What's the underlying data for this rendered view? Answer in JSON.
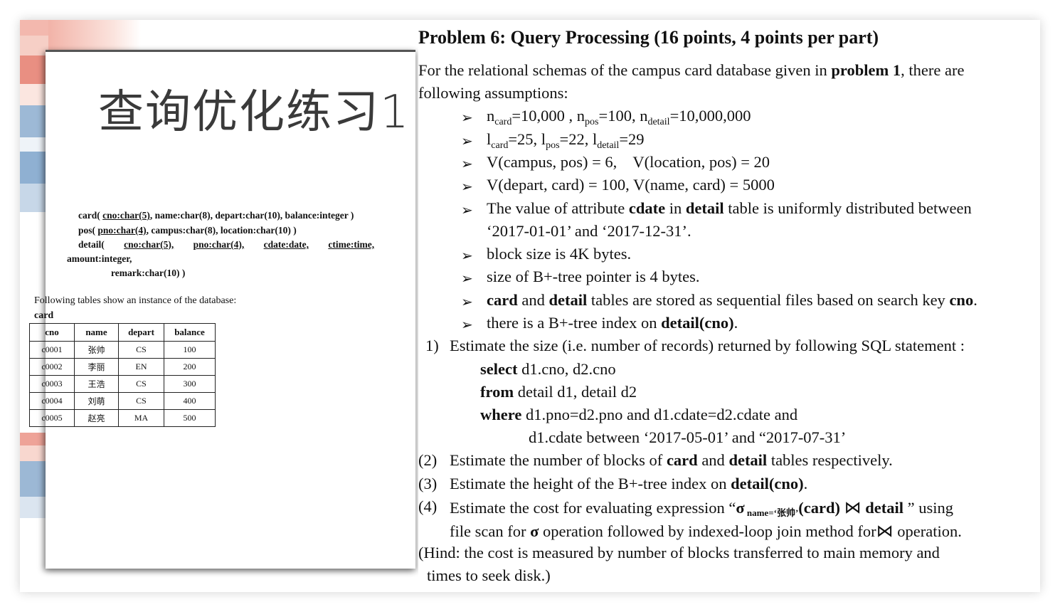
{
  "left": {
    "title": "查询优化练习1",
    "schema": {
      "card_prefix": "card( ",
      "card_key": "cno:char(5)",
      "card_rest": ", name:char(8), depart:char(10), balance:integer )",
      "pos_prefix": "pos( ",
      "pos_key": "pno:char(4)",
      "pos_rest": ", campus:char(8), location:char(10) )",
      "detail_prefix": "detail(",
      "detail_k1": "cno:char(5),",
      "detail_k2": "pno:char(4),",
      "detail_k3": "cdate:date,",
      "detail_k4": "ctime:time,",
      "detail_l2": "amount:integer,",
      "detail_l3": "remark:char(10) )"
    },
    "instance_note": "Following tables show an instance of the database:",
    "table_label": "card",
    "table": {
      "headers": [
        "cno",
        "name",
        "depart",
        "balance"
      ],
      "rows": [
        [
          "c0001",
          "张帅",
          "CS",
          "100"
        ],
        [
          "c0002",
          "李丽",
          "EN",
          "200"
        ],
        [
          "c0003",
          "王浩",
          "CS",
          "300"
        ],
        [
          "c0004",
          "刘萌",
          "CS",
          "400"
        ],
        [
          "c0005",
          "赵亮",
          "MA",
          "500"
        ]
      ]
    }
  },
  "right": {
    "problem_title": "Problem 6: Query Processing (16 points, 4 points per part)",
    "intro_a": "For the relational schemas of the campus card database given in ",
    "intro_b": "problem 1",
    "intro_c": ", there are",
    "intro_2": "following assumptions:",
    "b1": {
      "n": "n",
      "s1": "card",
      "t1": "=10,000 , n",
      "s2": "pos",
      "t2": "=100, n",
      "s3": "detail",
      "t3": "=10,000,000"
    },
    "b2": {
      "l": "l",
      "s1": "card",
      "t1": "=25, l",
      "s2": "pos",
      "t2": "=22, l",
      "s3": "detail",
      "t3": "=29"
    },
    "b3": "V(campus, pos) = 6,    V(location, pos) = 20",
    "b4": "V(depart, card) = 100, V(name, card) = 5000",
    "b5": {
      "a": "The value of attribute ",
      "b": "cdate",
      "c": " in ",
      "d": "detail",
      "e": " table is uniformly distributed between",
      "l2": "‘2017-01-01’ and ‘2017-12-31’."
    },
    "b6": "block size is 4K bytes.",
    "b7": "size of B+-tree pointer is 4 bytes.",
    "b8": {
      "a": "card",
      "b": " and ",
      "c": "detail",
      "d": " tables are stored as sequential files based on search key ",
      "e": "cno",
      "f": "."
    },
    "b9": {
      "a": "there is a B+-tree index on ",
      "b": "detail(cno)",
      "c": "."
    },
    "q1": {
      "num": "1)",
      "text": "Estimate the size (i.e. number of records) returned by following SQL statement :",
      "k1": "select",
      "t1": " d1.cno, d2.cno",
      "k2": "from",
      "t2": " detail d1, detail d2",
      "k3": "where",
      "t3": " d1.pno=d2.pno and d1.cdate=d2.cdate and",
      "t4": "d1.cdate between ‘2017-05-01’ and “2017-07-31’"
    },
    "q2": {
      "num": "(2)",
      "a": "Estimate the number of blocks of ",
      "b": "card",
      "c": " and ",
      "d": "detail",
      "e": " tables respectively."
    },
    "q3": {
      "num": "(3)",
      "a": "Estimate the height of the B+-tree index on ",
      "b": "detail(cno)",
      "c": "."
    },
    "q4": {
      "num": "(4)",
      "a": "Estimate the cost for evaluating expression “",
      "sigma": "σ",
      "cond": " name=‘张帅’",
      "b": "(card) ",
      "c": " detail",
      "d": " ” using",
      "l2a": "file scan for ",
      "l2b": "σ",
      "l2c": " operation followed by indexed-loop join method for",
      "l2d": " operation."
    },
    "hint1": "(Hind: the cost is measured by number of blocks transferred to main memory and",
    "hint2": "times to seek disk.)",
    "arrow": "➢",
    "join_symbol": "⋈"
  }
}
